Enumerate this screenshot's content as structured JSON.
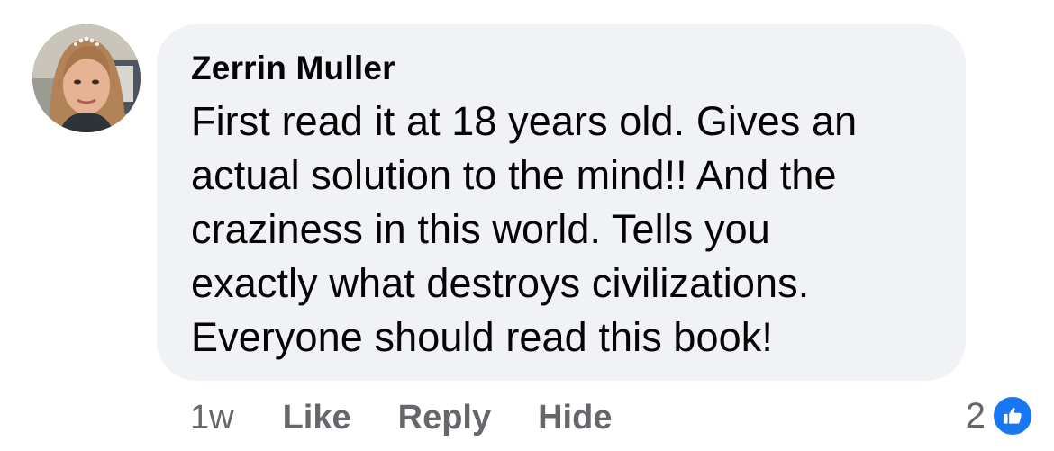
{
  "comment": {
    "author": "Zerrin Muller",
    "avatar_icon": "profile-photo",
    "body_lines": [
      "First read it at 18 years old. Gives an",
      "actual solution to the mind!! And the",
      "craziness in this world. Tells you",
      "exactly what destroys civilizations.",
      "Everyone should read this book!"
    ],
    "bubble_color": "#f0f2f5",
    "text_color": "#050505"
  },
  "actions": {
    "timestamp": "1w",
    "like_label": "Like",
    "reply_label": "Reply",
    "hide_label": "Hide",
    "action_color": "#65676b"
  },
  "reactions": {
    "count": "2",
    "icon": "like-thumbs-up-icon",
    "icon_color": "#1877f2"
  }
}
